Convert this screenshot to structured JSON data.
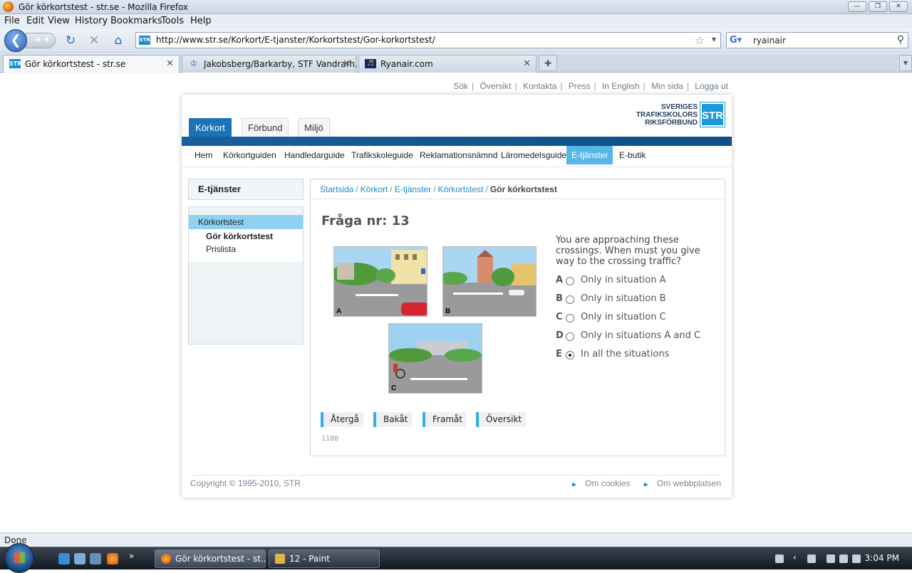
{
  "window": {
    "title": "Gör körkortstest - str.se - Mozilla Firefox",
    "minimize": "—",
    "maximize": "❐",
    "close": "✕"
  },
  "menu": [
    "File",
    "Edit",
    "View",
    "History",
    "Bookmarks",
    "Tools",
    "Help"
  ],
  "toolbar": {
    "url": "http://www.str.se/Korkort/E-tjanster/Korkortstest/Gor-korkortstest/",
    "search_value": "ryainair",
    "site_icon_text": "STR"
  },
  "tabs": [
    {
      "label": "Gör körkortstest - str.se",
      "icon": "STR"
    },
    {
      "label": "Jakobsberg/Barkarby, STF Vandrarh...",
      "icon": "crown-icon"
    },
    {
      "label": "Ryanair.com",
      "icon": "ryanair-harp-icon"
    }
  ],
  "page": {
    "util_links": [
      "Sök",
      "Översikt",
      "Kontakta",
      "Press",
      "In English",
      "Min sida",
      "Logga ut"
    ],
    "logo": {
      "line1": "SVERIGES",
      "line2": "TRAFIKSKOLORS",
      "line3": "RIKSFÖRBUND",
      "mark": "STR"
    },
    "section_tabs": [
      "Körkort",
      "Förbund",
      "Miljö"
    ],
    "top_nav": [
      "Hem",
      "Körkortguiden",
      "Handledarguide",
      "Trafikskoleguide",
      "Reklamationsnämnd",
      "Läromedelsguide",
      "E-tjänster",
      "E-butik"
    ],
    "left_title": "E-tjänster",
    "left_menu": [
      "Körkortstest",
      "Gör körkortstest",
      "Prislista"
    ],
    "breadcrumb": [
      "Startsida",
      "Körkort",
      "E-tjänster",
      "Körkortstest",
      "Gör körkortstest"
    ],
    "question_title": "Fråga nr: 13",
    "question_text": "You are approaching these crossings. When must you give way to the crossing traffic?",
    "image_labels": [
      "A",
      "B",
      "C"
    ],
    "options": [
      {
        "letter": "A",
        "text": "Only in situation A",
        "checked": false
      },
      {
        "letter": "B",
        "text": "Only in situation B",
        "checked": false
      },
      {
        "letter": "C",
        "text": "Only in situation C",
        "checked": false
      },
      {
        "letter": "D",
        "text": "Only in situations A and C",
        "checked": false
      },
      {
        "letter": "E",
        "text": "In all the situations",
        "checked": true
      }
    ],
    "nav_buttons": [
      "Återgå",
      "Bakåt",
      "Framåt",
      "Översikt"
    ],
    "question_id": "1180",
    "footer_copyright": "Copyright © 1995-2010, STR",
    "footer_links": [
      "Om cookies",
      "Om webbplatsen"
    ]
  },
  "status": "Done",
  "taskbar": {
    "tasks": [
      "Gör körkortstest - st...",
      "12 - Paint"
    ],
    "clock": "3:04 PM"
  },
  "colors": {
    "accent": "#1a72b8",
    "highlight": "#59b7e6",
    "link": "#1a8fd0"
  }
}
